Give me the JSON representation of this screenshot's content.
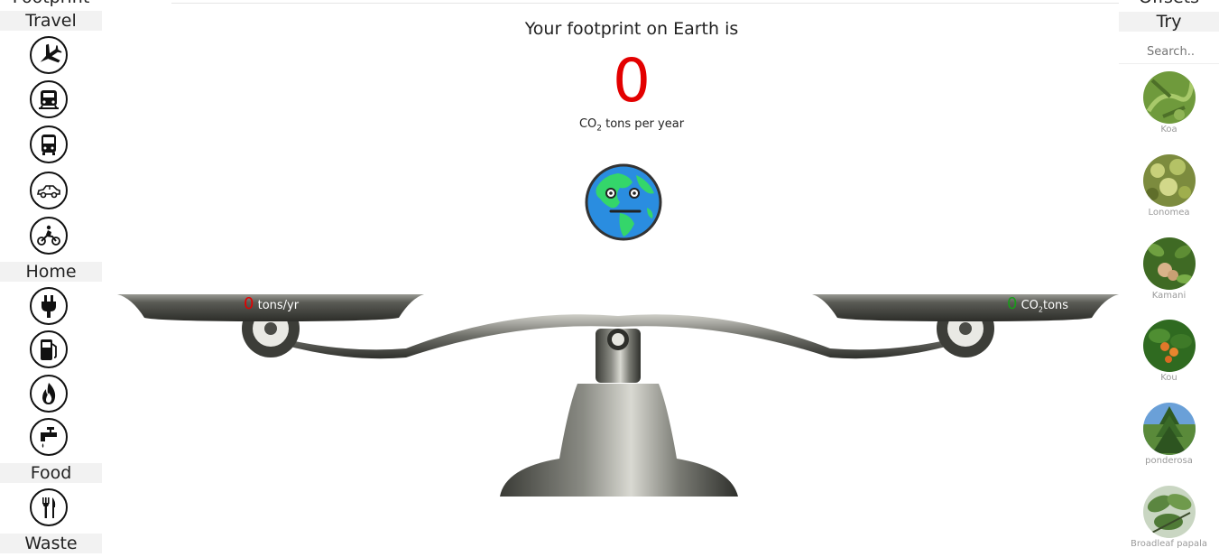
{
  "left_sidebar": {
    "partial_title": "Footprint",
    "sections": [
      {
        "title": "Travel",
        "items": [
          "airplane-icon",
          "train-icon",
          "bus-icon",
          "car-icon",
          "motorcycle-icon"
        ]
      },
      {
        "title": "Home",
        "items": [
          "electric-plug-icon",
          "fuel-pump-icon",
          "flame-icon",
          "water-faucet-icon"
        ]
      },
      {
        "title": "Food",
        "items": [
          "fork-knife-icon"
        ]
      },
      {
        "title": "Waste",
        "items": []
      }
    ]
  },
  "main": {
    "title": "Your footprint on Earth is",
    "value": "0",
    "unit_prefix": "CO",
    "unit_sub": "2",
    "unit_suffix": " tons per year",
    "earth_icon": "earth-face-icon",
    "value_color": "#e30000"
  },
  "scale": {
    "left_pan": {
      "value": "0",
      "unit": "tons/yr",
      "color": "#e30000"
    },
    "right_pan": {
      "value": "0",
      "unit_prefix": "CO",
      "unit_sub": "2",
      "unit_suffix": "tons",
      "color": "#1b9a1b"
    }
  },
  "right_sidebar": {
    "partial_title": "Offsets",
    "section_title": "Try",
    "search_placeholder": "Search..",
    "items": [
      {
        "name": "Koa"
      },
      {
        "name": "Lonomea"
      },
      {
        "name": "Kamani"
      },
      {
        "name": "Kou"
      },
      {
        "name": "ponderosa"
      },
      {
        "name": "Broadleaf papala"
      }
    ]
  }
}
